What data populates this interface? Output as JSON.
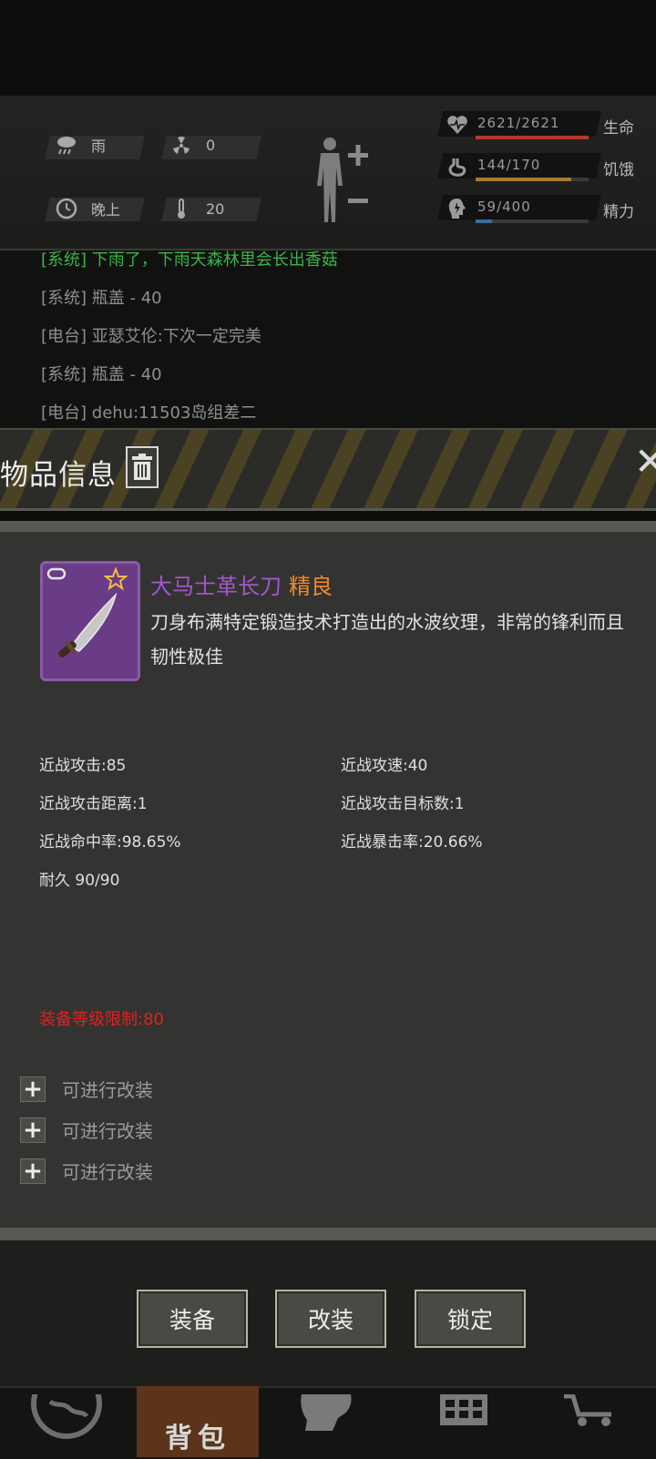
{
  "status": {
    "weather": "雨",
    "radiation": "0",
    "time_of_day": "晚上",
    "temperature": "20"
  },
  "stats": [
    {
      "value": "2621/2621",
      "label": "生命",
      "fill": 1.0,
      "color": "#b13a2e"
    },
    {
      "value": "144/170",
      "label": "饥饿",
      "fill": 0.847,
      "color": "#a77b2d"
    },
    {
      "value": "59/400",
      "label": "精力",
      "fill": 0.148,
      "color": "#3f6b9c"
    }
  ],
  "chat": [
    {
      "text": "[系统] 下雨了，下雨天森林里会长出香菇",
      "color": "#39b54a"
    },
    {
      "text": "[系统] 瓶盖 - 40",
      "color": "#8f8f8f"
    },
    {
      "text": "[电台] 亚瑟艾伦:下次一定完美",
      "color": "#8f8f8f"
    },
    {
      "text": "[系统] 瓶盖 - 40",
      "color": "#8f8f8f"
    },
    {
      "text": "[电台] dehu:11503岛组差二",
      "color": "#8f8f8f"
    }
  ],
  "modal": {
    "title": "物品信息",
    "item_name": "大马士革长刀",
    "item_rarity": "精良",
    "item_desc": "刀身布满特定锻造技术打造出的水波纹理，非常的锋利而且韧性极佳",
    "attributes": [
      "近战攻击:85",
      "近战攻速:40",
      "近战攻击距离:1",
      "近战攻击目标数:1",
      "近战命中率:98.65%",
      "近战暴击率:20.66%",
      "耐久 90/90"
    ],
    "level_requirement": "装备等级限制:80",
    "mod_slots": [
      "可进行改装",
      "可进行改装",
      "可进行改装"
    ],
    "buttons": {
      "equip": "装备",
      "modify": "改装",
      "lock": "锁定"
    }
  },
  "nav": {
    "active_label": "背包"
  },
  "colors": {
    "rarity": "#f08a2a",
    "item_name": "#a455cf",
    "level_req": "#e02121"
  }
}
